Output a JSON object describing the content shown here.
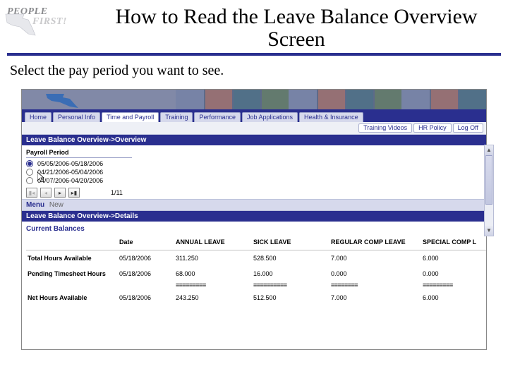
{
  "logo": {
    "line1": "PEOPLE",
    "line2": "FIRST!"
  },
  "title": "How to Read the Leave Balance Overview Screen",
  "instruction": "Select the pay period you want to see.",
  "nav_tabs": [
    "Home",
    "Personal Info",
    "Time and Payroll",
    "Training",
    "Performance",
    "Job Applications",
    "Health & Insurance"
  ],
  "nav_active": "Time and Payroll",
  "header_buttons": [
    "Training Videos",
    "HR Policy",
    "Log Off"
  ],
  "section_overview": "Leave Balance Overview->Overview",
  "payroll_period_label": "Payroll Period",
  "payroll_periods": [
    {
      "label": "05/05/2006-05/18/2006",
      "selected": true
    },
    {
      "label": "04/21/2006-05/04/2006",
      "selected": false
    },
    {
      "label": "04/07/2006-04/20/2006",
      "selected": false
    }
  ],
  "pager": {
    "page": "1/11"
  },
  "menu_bar": {
    "menu": "Menu",
    "new": "New"
  },
  "section_details": "Leave Balance Overview->Details",
  "current_balances_label": "Current Balances",
  "columns": [
    "",
    "Date",
    "ANNUAL LEAVE",
    "SICK LEAVE",
    "REGULAR COMP LEAVE",
    "SPECIAL COMP L"
  ],
  "rows": [
    {
      "label": "Total Hours Available",
      "date": "05/18/2006",
      "values": [
        "311.250",
        "528.500",
        "7.000",
        "6.000"
      ]
    },
    {
      "label": "Pending Timesheet Hours",
      "date": "05/18/2006",
      "values": [
        "68.000",
        "16.000",
        "0.000",
        "0.000"
      ]
    }
  ],
  "divider_cells": [
    "=========",
    "==========",
    "========",
    "========="
  ],
  "net_row": {
    "label": "Net Hours Available",
    "date": "05/18/2006",
    "values": [
      "243.250",
      "512.500",
      "7.000",
      "6.000"
    ]
  }
}
